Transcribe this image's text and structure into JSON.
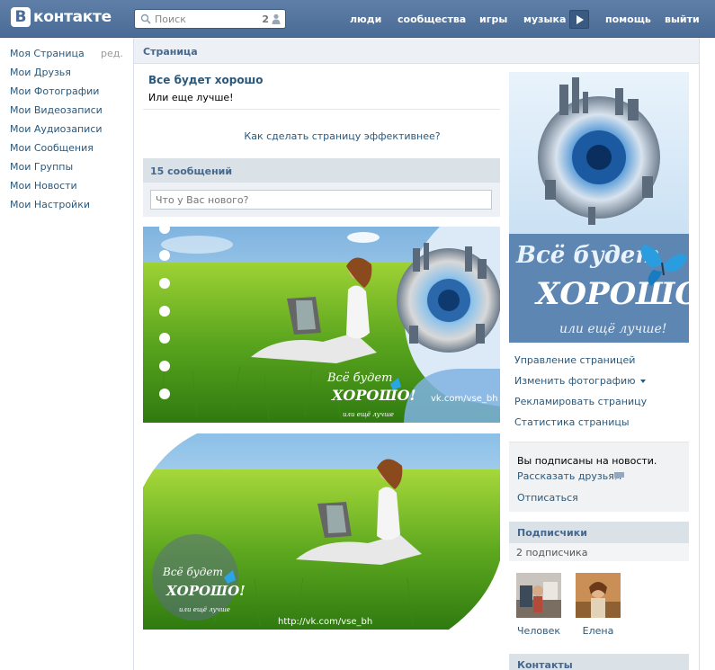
{
  "header": {
    "logo_letter": "В",
    "logo_text": "контакте",
    "search_placeholder": "Поиск",
    "search_count": "2",
    "nav": [
      "люди",
      "сообщества",
      "игры",
      "музыка",
      "помощь",
      "выйти"
    ]
  },
  "left_menu": {
    "items": [
      "Моя Страница",
      "Мои Друзья",
      "Мои Фотографии",
      "Мои Видеозаписи",
      "Мои Аудиозаписи",
      "Мои Сообщения",
      "Мои Группы",
      "Мои Новости",
      "Мои Настройки"
    ],
    "edit_label": "ред."
  },
  "page": {
    "section_title": "Страница",
    "name": "Все будет хорошо",
    "status": "Или еще лучше!",
    "tip_link": "Как сделать страницу эффективнее?"
  },
  "wall": {
    "count_label": "15 сообщений",
    "placeholder": "Что у Вас нового?",
    "posts": [
      {
        "image": "girl-in-grass-with-laptop",
        "caption_script": "Всё будет ХОРОШО!",
        "caption_small": "или ещё лучше",
        "url": "vk.com/vse_bh"
      },
      {
        "image": "girl-in-grass-with-laptop",
        "caption_script": "Всё будет ХОРОШО!",
        "caption_small": "или ещё лучше",
        "url": "http://vk.com/vse_bh"
      }
    ]
  },
  "avatar": {
    "line1": "Всё будет",
    "line2": "ХОРОШО!",
    "line3": "или ещё лучше!"
  },
  "actions": {
    "manage": "Управление страницей",
    "change_photo": "Изменить фотографию",
    "advertise": "Рекламировать страницу",
    "stats": "Статистика страницы"
  },
  "subscription": {
    "text": "Вы подписаны на новости.",
    "tell_friends": "Рассказать друзьям",
    "unsubscribe": "Отписаться"
  },
  "subscribers": {
    "title": "Подписчики",
    "count": "2 подписчика",
    "people": [
      {
        "name": "Человек"
      },
      {
        "name": "Елена"
      }
    ]
  },
  "contacts": {
    "title": "Контакты"
  },
  "colors": {
    "header_blue": "#4a6b95",
    "link_blue": "#2b587a",
    "section_bg": "#dae2e8"
  }
}
